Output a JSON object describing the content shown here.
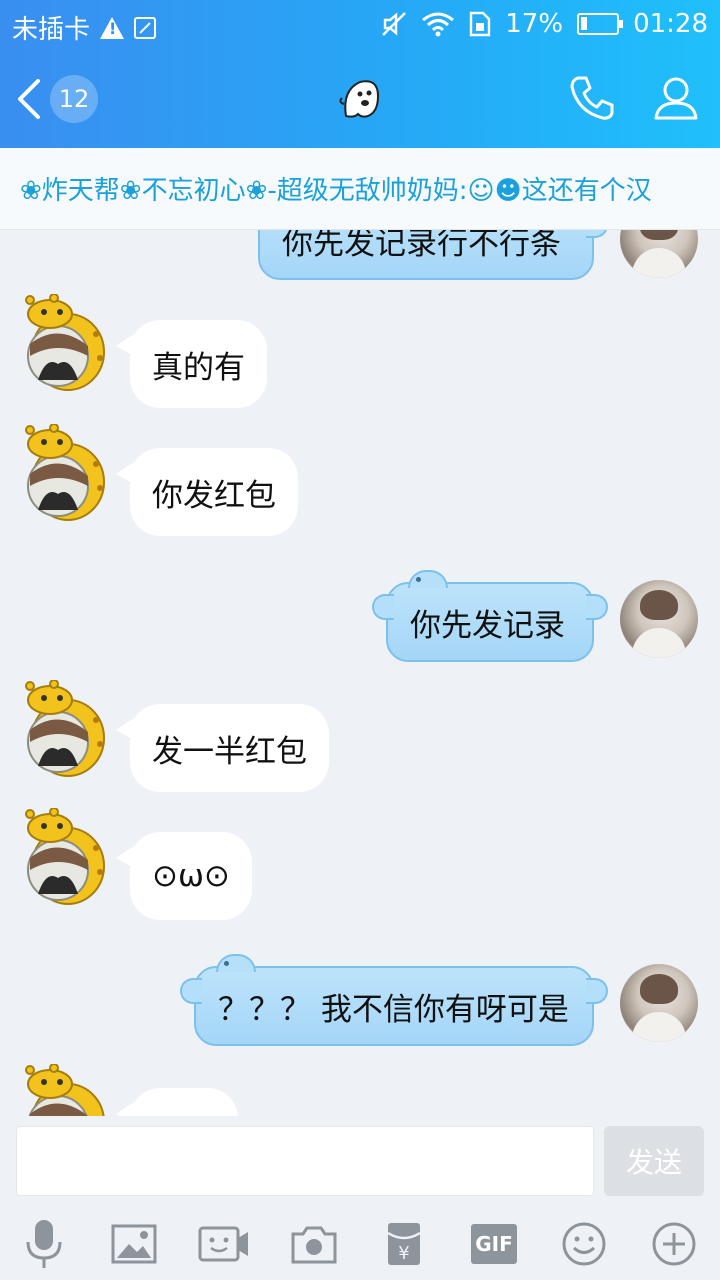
{
  "status_bar": {
    "carrier": "未插卡",
    "battery": "17%",
    "battery_level": 0.17,
    "time": "01:28"
  },
  "title_bar": {
    "back_badge": "12",
    "icons": [
      "back-chevron-icon",
      "ghost-icon",
      "phone-icon",
      "profile-icon"
    ]
  },
  "banner": {
    "text": "❀炸天帮❀不忘初心❀-超级无敌帅奶妈:☺☻这还有个汉"
  },
  "messages": [
    {
      "side": "out",
      "text": "你先发记录行不行条"
    },
    {
      "side": "in",
      "text": "真的有"
    },
    {
      "side": "in",
      "text": "你发红包"
    },
    {
      "side": "out",
      "text": "你先发记录"
    },
    {
      "side": "in",
      "text": "发一半红包"
    },
    {
      "side": "in",
      "text": "⊙ω⊙"
    },
    {
      "side": "out",
      "text": "？？？ 我不信你有呀可是"
    },
    {
      "side": "in",
      "text": ""
    }
  ],
  "input": {
    "value": "",
    "placeholder": "",
    "send_label": "发送"
  },
  "toolbar": {
    "icons": [
      "microphone-icon",
      "image-icon",
      "video-call-icon",
      "camera-icon",
      "red-packet-icon",
      "gif-icon",
      "emoji-icon",
      "plus-icon"
    ],
    "gif_label": "GIF"
  },
  "colors": {
    "header_start": "#3a8ef0",
    "header_end": "#1fc0fb",
    "outgoing_bubble": "#a4d6f7",
    "banner_text": "#1aa0dc"
  }
}
